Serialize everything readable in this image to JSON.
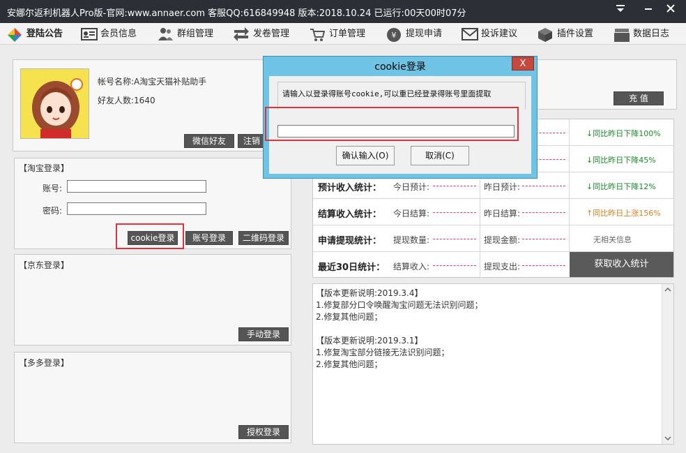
{
  "app": {
    "title": "安娜尔返利机器人Pro版-官网:www.annaer.com 客服QQ:616849948  版本:2018.10.24    已运行:00天00时07分"
  },
  "nav": [
    {
      "label": "登陆公告",
      "icon": "google-diamond-icon"
    },
    {
      "label": "会员信息",
      "icon": "id-card-icon"
    },
    {
      "label": "群组管理",
      "icon": "group-icon"
    },
    {
      "label": "发卷管理",
      "icon": "transfer-arrows-icon"
    },
    {
      "label": "订单管理",
      "icon": "cart-icon"
    },
    {
      "label": "提现申请",
      "icon": "yen-coin-icon"
    },
    {
      "label": "投诉建议",
      "icon": "envelope-icon"
    },
    {
      "label": "插件设置",
      "icon": "cube-icon"
    },
    {
      "label": "数据日志",
      "icon": "folder-stack-icon"
    }
  ],
  "account": {
    "name": "帐号名称:A淘宝天猫补贴助手",
    "friends": "好友人数:1640",
    "btn_wechat": "微信好友",
    "btn_logout": "注销",
    "btn_recharge": "充  值"
  },
  "taobao": {
    "legend": "【淘宝登录】",
    "account_label": "账号:",
    "password_label": "密码:",
    "account_value": "",
    "password_value": "",
    "btn_cookie": "cookie登录",
    "btn_account": "账号登录",
    "btn_qrcode": "二维码登录"
  },
  "jd": {
    "legend": "【京东登录】",
    "btn_manual": "手动登录"
  },
  "pdd": {
    "legend": "【多多登录】",
    "btn_auth": "授权登录"
  },
  "stats": {
    "rows": [
      {
        "label": "",
        "c1": "",
        "c2": "",
        "cmp": "↓同比昨日下降100%",
        "dir": "down"
      },
      {
        "label": "",
        "c1": "",
        "c2": "",
        "cmp": "↓同比昨日下降45%",
        "dir": "down"
      },
      {
        "label": "预计收入统计：",
        "c1": "今日预计:",
        "c2": "昨日预计:",
        "cmp": "↓同比昨日下降12%",
        "dir": "down"
      },
      {
        "label": "结算收入统计：",
        "c1": "今日结算:",
        "c2": "昨日结算:",
        "cmp": "↑同比昨日上涨156%",
        "dir": "up"
      },
      {
        "label": "申请提现统计：",
        "c1": "提现数量:",
        "c2": "提现金额:",
        "cmp": "无相关信息",
        "dir": "none"
      },
      {
        "label": "最近30日统计：",
        "c1": "结算收入:",
        "c2": "提现支出:",
        "cmp": "",
        "dir": "none"
      }
    ],
    "btn_fetch": "获取收入统计"
  },
  "notes": [
    "【版本更新说明:2019.3.4】",
    "1.修复部分口令唤醒淘宝问题无法识别问题；",
    "2.修复其他问题；",
    "",
    "【版本更新说明:2019.3.1】",
    "1.修复淘宝部分链接无法识别问题；",
    "2.修复其他问题；"
  ],
  "dialog": {
    "title": "cookie登录",
    "close": "X",
    "prompt": "请输入以登录得账号cookie,可以重已经登录得账号里面提取",
    "input_value": "",
    "btn_confirm": "确认输入(O)",
    "btn_cancel": "取消(C)"
  },
  "colors": {
    "titlebar": "#2c2f36",
    "dialog_frame": "#6fc3e4",
    "highlight": "#e3303a",
    "down": "#1a8a2a",
    "up": "#d8801a"
  }
}
